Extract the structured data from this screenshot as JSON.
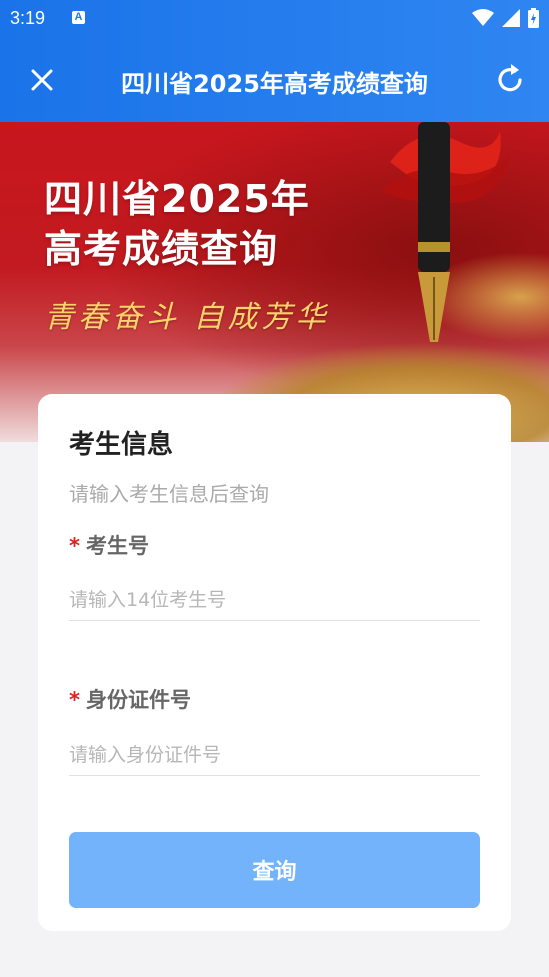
{
  "status_bar": {
    "time": "3:19",
    "notification_icon": "A"
  },
  "title_bar": {
    "title": "四川省2025年高考成绩查询"
  },
  "banner": {
    "headline_line1": "四川省2025年",
    "headline_line2": "高考成绩查询",
    "slogan": "青春奋斗 自成芳华"
  },
  "form": {
    "heading": "考生信息",
    "subtitle": "请输入考生信息后查询",
    "fields": [
      {
        "label": "考生号",
        "required_mark": "*",
        "placeholder": "请输入14位考生号",
        "value": ""
      },
      {
        "label": "身份证件号",
        "required_mark": "*",
        "placeholder": "请输入身份证件号",
        "value": ""
      }
    ],
    "submit_label": "查询"
  },
  "colors": {
    "header_blue": "#1a73e8",
    "button_blue": "#73b3fb",
    "required_red": "#e02020",
    "banner_red": "#c8161d"
  }
}
